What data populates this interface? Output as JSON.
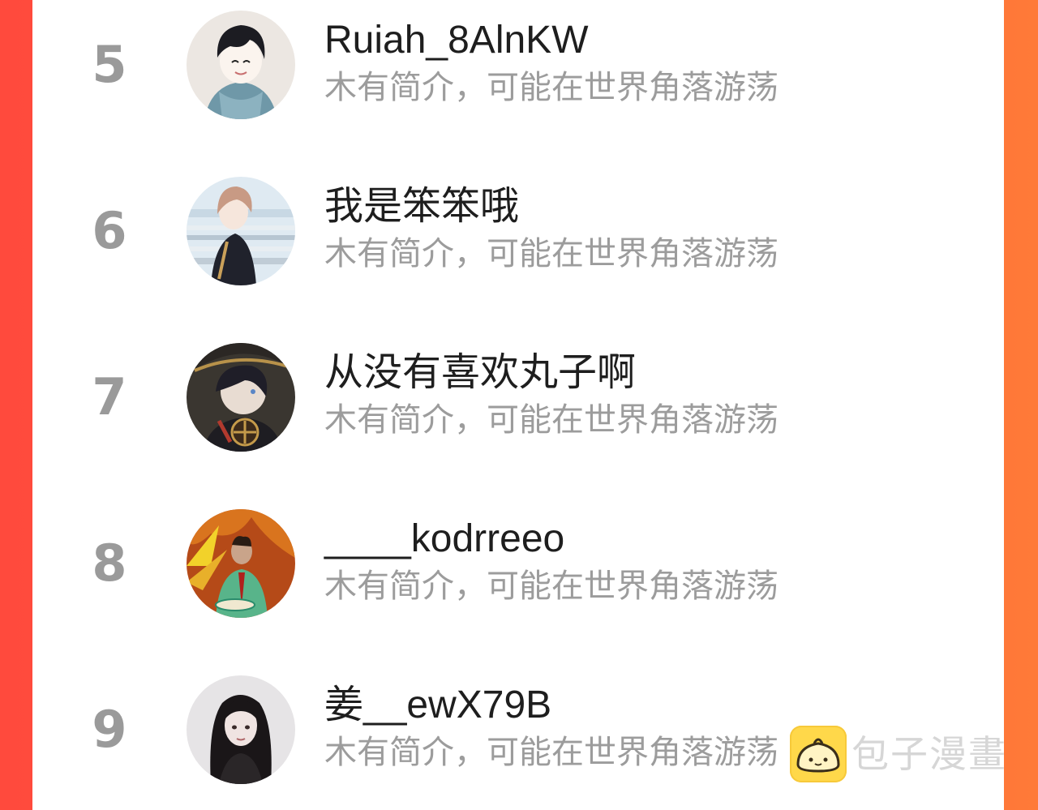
{
  "ranking": {
    "items": [
      {
        "rank": "5",
        "username": "Ruiah_8AlnKW",
        "bio": "木有简介，可能在世界角落游荡",
        "avatar_icon": "boy-hoodie-avatar-icon"
      },
      {
        "rank": "6",
        "username": "我是笨笨哦",
        "bio": "木有简介，可能在世界角落游荡",
        "avatar_icon": "girl-schoolyard-avatar-icon"
      },
      {
        "rank": "7",
        "username": "从没有喜欢丸子啊",
        "bio": "木有简介，可能在世界角落游荡",
        "avatar_icon": "anime-hat-character-avatar-icon"
      },
      {
        "rank": "8",
        "username": "____kodrreeo",
        "bio": "木有简介，可能在世界角落游荡",
        "avatar_icon": "fire-monk-avatar-icon"
      },
      {
        "rank": "9",
        "username": "姜__ewX79B",
        "bio": "木有简介，可能在世界角落游荡",
        "avatar_icon": "dark-hair-girl-avatar-icon"
      }
    ]
  },
  "watermark": {
    "text": "包子漫畫",
    "icon": "bun-logo-icon"
  },
  "colors": {
    "background_left": "#ff4a3d",
    "background_right": "#ff7a38",
    "rank_gray": "#9a9a9a",
    "username": "#1e1e1e",
    "bio_gray": "#9c9c9c",
    "logo_yellow": "#ffd84a"
  }
}
